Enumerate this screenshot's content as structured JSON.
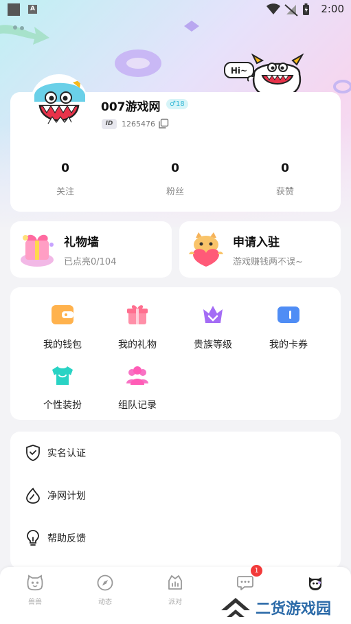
{
  "status": {
    "time": "2:00"
  },
  "profile": {
    "name": "007游戏网",
    "gender_level": "♂18",
    "id_tag": "ID",
    "id_number": "1265476",
    "stats": [
      {
        "value": "0",
        "label": "关注"
      },
      {
        "value": "0",
        "label": "粉丝"
      },
      {
        "value": "0",
        "label": "获赞"
      }
    ],
    "bubble_text": "Hi~"
  },
  "cards": {
    "gift_wall": {
      "title": "礼物墙",
      "subtitle": "已点亮0/104"
    },
    "apply": {
      "title": "申请入驻",
      "subtitle": "游戏赚钱两不误~"
    }
  },
  "grid": {
    "items": [
      {
        "label": "我的钱包",
        "icon": "wallet-icon"
      },
      {
        "label": "我的礼物",
        "icon": "gift-icon"
      },
      {
        "label": "贵族等级",
        "icon": "crown-icon"
      },
      {
        "label": "我的卡券",
        "icon": "coupon-icon"
      },
      {
        "label": "个性装扮",
        "icon": "tshirt-icon"
      },
      {
        "label": "组队记录",
        "icon": "team-icon"
      }
    ]
  },
  "menu": {
    "items": [
      {
        "label": "实名认证",
        "icon": "shield-icon"
      },
      {
        "label": "净网计划",
        "icon": "leaf-icon"
      },
      {
        "label": "帮助反馈",
        "icon": "bulb-icon"
      }
    ]
  },
  "tabbar": {
    "items": [
      {
        "label": "兽兽",
        "icon": "pet-icon"
      },
      {
        "label": "动态",
        "icon": "compass-icon"
      },
      {
        "label": "派对",
        "icon": "party-icon"
      },
      {
        "label": "",
        "icon": "message-icon"
      },
      {
        "label": "",
        "icon": "mine-icon"
      }
    ],
    "badge": "1"
  },
  "watermark": {
    "text": "二货游戏园"
  },
  "colors": {
    "accent": "#38b9d6",
    "badge": "#f23a3a",
    "watermark": "#2b6aa8"
  }
}
